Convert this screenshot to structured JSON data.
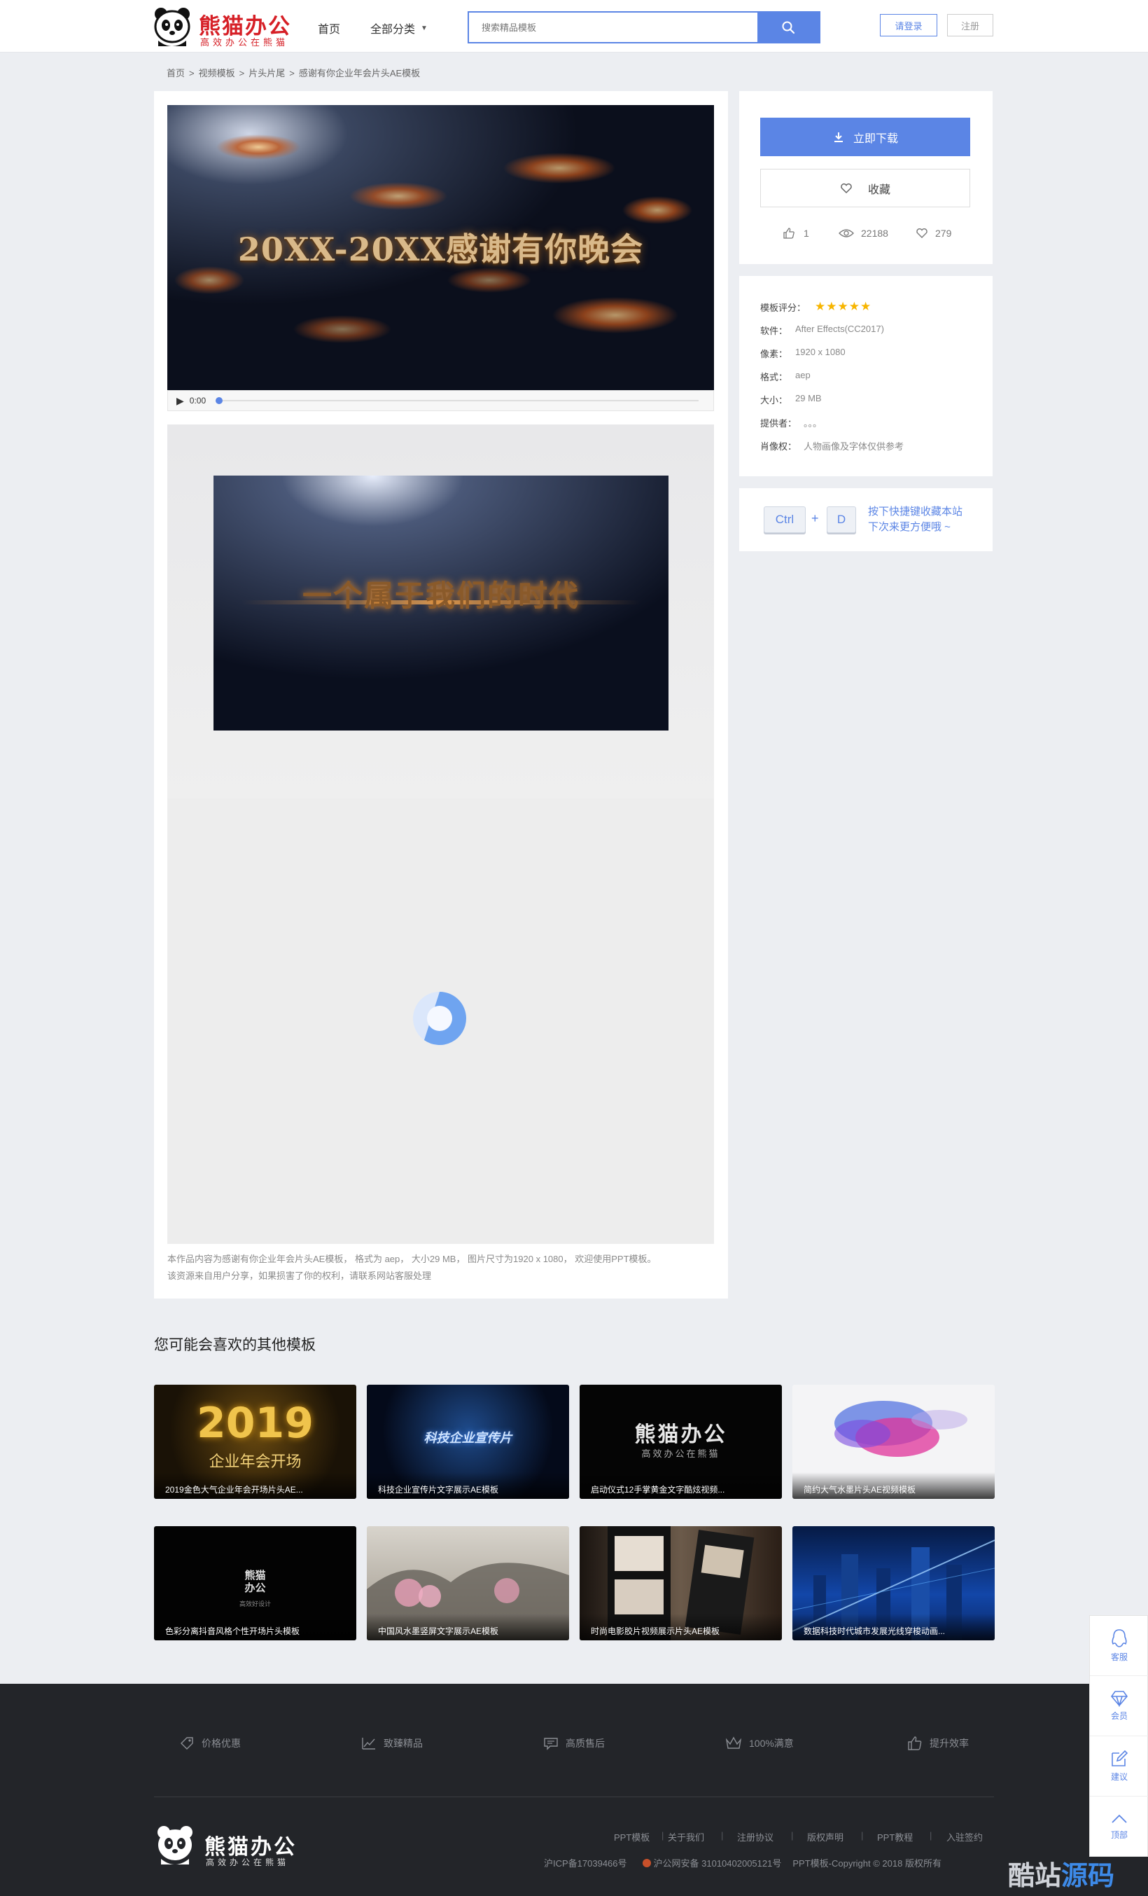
{
  "header": {
    "logo_title": "熊猫办公",
    "logo_sub": "高效办公在熊猫",
    "nav_home": "首页",
    "nav_all": "全部分类",
    "search_placeholder": "搜索精品模板",
    "login": "请登录",
    "register": "注册"
  },
  "breadcrumb": [
    "首页",
    ">",
    "视频模板",
    ">",
    "片头片尾",
    ">",
    "感谢有你企业年会片头AE模板"
  ],
  "player": {
    "video_title": "20XX-20XX感谢有你晚会",
    "time": "0:00"
  },
  "preview": {
    "text": "一个属于我们的时代"
  },
  "description": {
    "line1": "本作品内容为感谢有你企业年会片头AE模板， 格式为 aep， 大小29 MB， 图片尺寸为1920 x 1080， 欢迎使用PPT模板。",
    "line2": "该资源来自用户分享，如果损害了你的权利，请联系网站客服处理"
  },
  "actions": {
    "download": "立即下载",
    "favorite": "收藏",
    "likes": "1",
    "views": "22188",
    "favorites": "279"
  },
  "info": {
    "rating_label": "模板评分：",
    "rating": 5,
    "software_label": "软件：",
    "software": "After Effects(CC2017)",
    "pixels_label": "像素：",
    "pixels": "1920 x 1080",
    "format_label": "格式：",
    "format": "aep",
    "size_label": "大小：",
    "size": "29 MB",
    "provider_label": "提供者：",
    "provider": "。。。",
    "portrait_label": "肖像权：",
    "portrait": "人物画像及字体仅供参考"
  },
  "shortcut": {
    "key1": "Ctrl",
    "plus": "+",
    "key2": "D",
    "line1": "按下快捷键收藏本站",
    "line2": "下次来更方便哦 ~"
  },
  "recommend": {
    "title": "您可能会喜欢的其他模板",
    "items": [
      {
        "caption": "2019金色大气企业年会开场片头AE...",
        "overlay": "2019",
        "sub": "企业年会开场"
      },
      {
        "caption": "科技企业宣传片文字展示AE模板",
        "overlay": "科技企业宣传片",
        "sub": ""
      },
      {
        "caption": "启动仪式12手掌黄金文字酷炫视频...",
        "overlay": "熊猫办公",
        "sub": "高效办公在熊猫"
      },
      {
        "caption": "简约大气水墨片头AE视频模板",
        "overlay": "",
        "sub": ""
      },
      {
        "caption": "色彩分离抖音风格个性开场片头模板",
        "overlay": "熊猫\n办公",
        "sub": "高效好设计"
      },
      {
        "caption": "中国风水墨竖屏文字展示AE模板",
        "overlay": "",
        "sub": ""
      },
      {
        "caption": "时尚电影胶片视频展示片头AE模板",
        "overlay": "",
        "sub": ""
      },
      {
        "caption": "数据科技时代城市发展光线穿梭动画...",
        "overlay": "",
        "sub": ""
      }
    ]
  },
  "footer": {
    "features": [
      "价格优惠",
      "致臻精品",
      "高质售后",
      "100%满意",
      "提升效率"
    ],
    "logo_title": "熊猫办公",
    "logo_sub": "高效办公在熊猫",
    "links": [
      "PPT模板",
      "关于我们",
      "注册协议",
      "版权声明",
      "PPT教程",
      "入驻签约"
    ],
    "icp": "沪ICP备17039466号",
    "police": "沪公网安备 31010402005121号",
    "copyright": "PPT模板-Copyright © 2018 版权所有"
  },
  "side": [
    "客服",
    "会员",
    "建议",
    "顶部"
  ],
  "watermark": {
    "part1": "酷站",
    "part2": "源码"
  },
  "colors": {
    "accent": "#5b85e5",
    "brand": "#d61f26",
    "footer_bg": "#232529",
    "star": "#f7b500"
  }
}
